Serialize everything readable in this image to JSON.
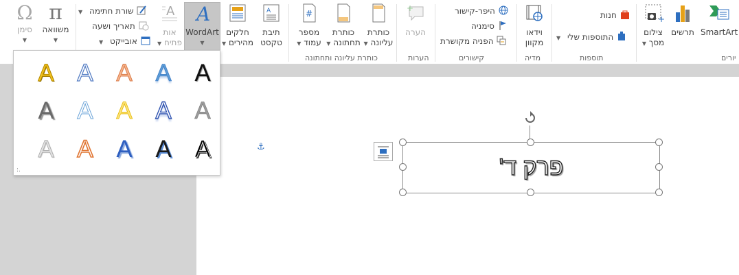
{
  "ribbon": {
    "groups": {
      "illustrations_partial": "יורים",
      "addins": "תוספות",
      "media": "מדיה",
      "links": "קישורים",
      "comments": "הערות",
      "header_footer": "כותרת עליונה ותחתונה"
    },
    "buttons": {
      "smartart": "SmartArt",
      "chart": "תרשים",
      "screenshot_1": "צילום",
      "screenshot_2": "מסך",
      "store": "חנות",
      "my_addins": "התוספות שלי",
      "online_video_1": "וידאו",
      "online_video_2": "מקוון",
      "hyperlink": "היפר-קישור",
      "bookmark": "סימניה",
      "cross_reference": "הפניה מקושרת",
      "comment": "הערה",
      "header_1": "כותרת",
      "header_2": "עליונה",
      "footer_1": "כותרת",
      "footer_2": "תחתונה",
      "page_number_1": "מספר",
      "page_number_2": "עמוד",
      "text_box_1": "תיבת",
      "text_box_2": "טקסט",
      "quick_parts_1": "חלקים",
      "quick_parts_2": "מהירים",
      "wordart": "WordArt",
      "drop_cap_1": "אות",
      "drop_cap_2": "פתיח",
      "signature_line": "שורת חתימה",
      "date_time": "תאריך ושעה",
      "object": "אובייקט",
      "equation": "משוואה",
      "symbol": "סימן"
    }
  },
  "gallery": {
    "glyph": "A",
    "grip": ":."
  },
  "document": {
    "textbox_text": "פרק ד'"
  },
  "colors": {
    "wordart_blue": "#2e6fc0",
    "selected_button": "#c6c6c6",
    "page_bg": "#ffffff",
    "workspace_bg": "#d4d4d4"
  }
}
